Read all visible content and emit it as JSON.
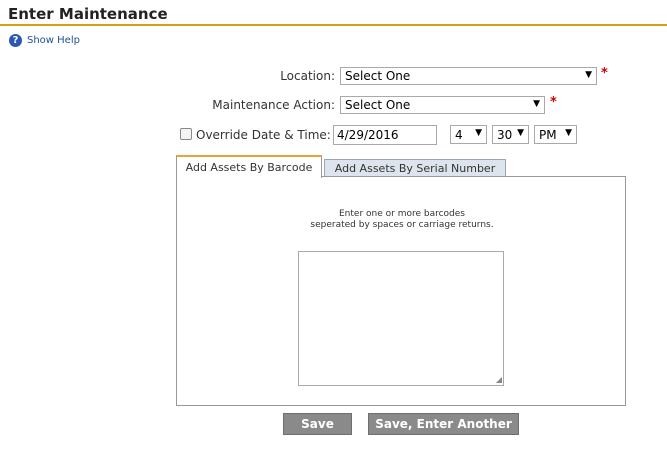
{
  "header": {
    "title": "Enter Maintenance"
  },
  "help": {
    "label": "Show Help",
    "icon": "?"
  },
  "form": {
    "location_label": "Location:",
    "location_value": "Select One",
    "action_label": "Maintenance Action:",
    "action_value": "Select One",
    "required_marker": "*",
    "override_label": "Override Date & Time:",
    "override_checked": false,
    "date_value": "4/29/2016",
    "hour_value": "4",
    "minute_value": "30",
    "ampm_value": "PM"
  },
  "tabs": [
    {
      "label": "Add Assets By Barcode",
      "active": true
    },
    {
      "label": "Add Assets By Serial Number",
      "active": false
    }
  ],
  "barcode_panel": {
    "instruction_line1": "Enter one or more barcodes",
    "instruction_line2": "seperated by spaces or carriage returns."
  },
  "buttons": {
    "save": "Save",
    "save_another": "Save, Enter Another"
  },
  "colors": {
    "title_rule": "#d4a017",
    "required": "#cc0000",
    "active_tab_accent": "#e8a33a",
    "button_bg": "#8a8a8a",
    "help_icon": "#2a57b4"
  }
}
